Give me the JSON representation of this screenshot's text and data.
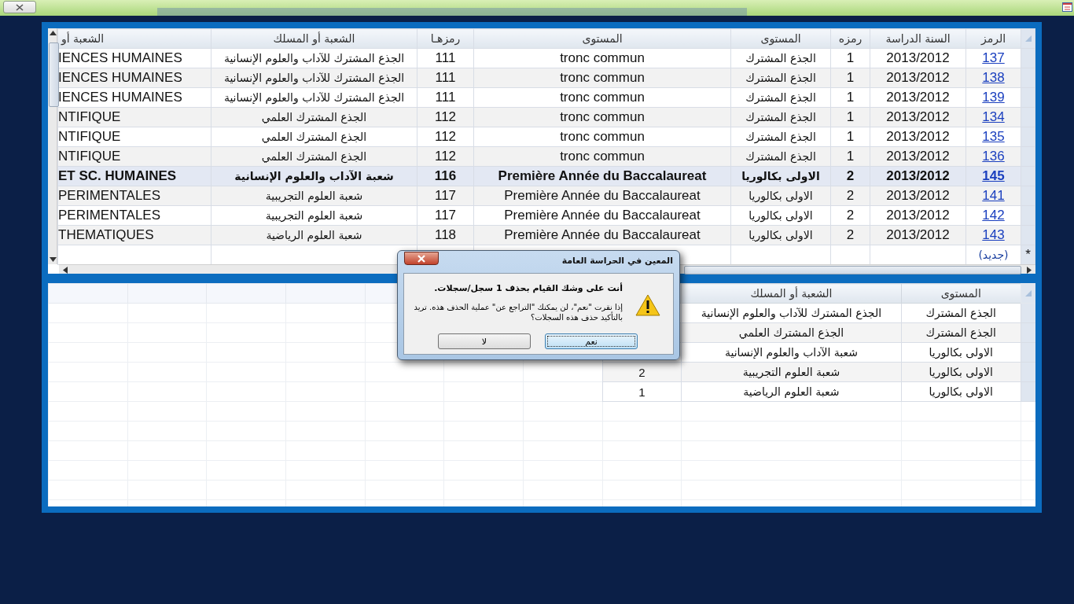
{
  "records_table": {
    "columns": [
      "الرمز",
      "السنة الدراسة",
      "رمزه",
      "المستوى",
      "المستوى",
      "رمزهـا",
      "الشعبة أو المسلك",
      "الشعبة أو"
    ],
    "rows": [
      {
        "code": "137",
        "year": "2013/2012",
        "level_code": "1",
        "level_ar": "الجذع المشترك",
        "level_fr": "tronc commun",
        "branch_code": "111",
        "branch_ar": "الجذع المشترك للآداب والعلوم الإنسانية",
        "branch_fr": "IENCES HUMAINES",
        "selected": false
      },
      {
        "code": "138",
        "year": "2013/2012",
        "level_code": "1",
        "level_ar": "الجذع المشترك",
        "level_fr": "tronc commun",
        "branch_code": "111",
        "branch_ar": "الجذع المشترك للآداب والعلوم الإنسانية",
        "branch_fr": "IENCES HUMAINES",
        "selected": false
      },
      {
        "code": "139",
        "year": "2013/2012",
        "level_code": "1",
        "level_ar": "الجذع المشترك",
        "level_fr": "tronc commun",
        "branch_code": "111",
        "branch_ar": "الجذع المشترك للآداب والعلوم الإنسانية",
        "branch_fr": "IENCES HUMAINES",
        "selected": false
      },
      {
        "code": "134",
        "year": "2013/2012",
        "level_code": "1",
        "level_ar": "الجذع المشترك",
        "level_fr": "tronc commun",
        "branch_code": "112",
        "branch_ar": "الجذع المشترك العلمي",
        "branch_fr": "NTIFIQUE",
        "selected": false
      },
      {
        "code": "135",
        "year": "2013/2012",
        "level_code": "1",
        "level_ar": "الجذع المشترك",
        "level_fr": "tronc commun",
        "branch_code": "112",
        "branch_ar": "الجذع المشترك العلمي",
        "branch_fr": "NTIFIQUE",
        "selected": false
      },
      {
        "code": "136",
        "year": "2013/2012",
        "level_code": "1",
        "level_ar": "الجذع المشترك",
        "level_fr": "tronc commun",
        "branch_code": "112",
        "branch_ar": "الجذع المشترك العلمي",
        "branch_fr": "NTIFIQUE",
        "selected": false
      },
      {
        "code": "145",
        "year": "2013/2012",
        "level_code": "2",
        "level_ar": "الاولى بكالوريا",
        "level_fr": "Première Année du Baccalaureat",
        "branch_code": "116",
        "branch_ar": "شعبة الآداب والعلوم الإنسانية",
        "branch_fr": "ET SC. HUMAINES",
        "selected": true
      },
      {
        "code": "141",
        "year": "2013/2012",
        "level_code": "2",
        "level_ar": "الاولى بكالوريا",
        "level_fr": "Première Année du Baccalaureat",
        "branch_code": "117",
        "branch_ar": "شعبة العلوم التجريبية",
        "branch_fr": "PERIMENTALES",
        "selected": false
      },
      {
        "code": "142",
        "year": "2013/2012",
        "level_code": "2",
        "level_ar": "الاولى بكالوريا",
        "level_fr": "Première Année du Baccalaureat",
        "branch_code": "117",
        "branch_ar": "شعبة العلوم التجريبية",
        "branch_fr": "PERIMENTALES",
        "selected": false
      },
      {
        "code": "143",
        "year": "2013/2012",
        "level_code": "2",
        "level_ar": "الاولى بكالوريا",
        "level_fr": "Première Année du Baccalaureat",
        "branch_code": "118",
        "branch_ar": "شعبة العلوم الرياضية",
        "branch_fr": "THEMATIQUES",
        "selected": false
      }
    ],
    "new_row": {
      "marker": "*",
      "label": "(جديد)"
    }
  },
  "summary_table": {
    "columns": [
      "المستوى",
      "الشعبة أو المسلك"
    ],
    "rows": [
      {
        "level": "الجذع المشترك",
        "branch": "الجذع المشترك للآداب والعلوم الإنسانية"
      },
      {
        "level": "الجذع المشترك",
        "branch": "الجذع المشترك العلمي"
      },
      {
        "level": "الاولى بكالوريا",
        "branch": "شعبة الآداب والعلوم الإنسانية"
      },
      {
        "level": "الاولى بكالوريا",
        "branch": "شعبة العلوم التجريبية",
        "column_3": "2"
      },
      {
        "level": "الاولى بكالوريا",
        "branch": "شعبة العلوم الرياضية",
        "column_3": "1"
      }
    ]
  },
  "dialog": {
    "title": "المعين في الحراسة العامة",
    "heading": "أنت على وشك القيام بحذف 1 سجل/سجلات.",
    "message": "إذا نقرت \"نعم\"، لن يمكنك \"التراجع عن\" عملية الحذف هذه. تريد بالتأكيد حذف هذه السجلات؟",
    "buttons": [
      {
        "label": "نعم",
        "focused": true
      },
      {
        "label": "لا",
        "focused": false
      }
    ]
  }
}
